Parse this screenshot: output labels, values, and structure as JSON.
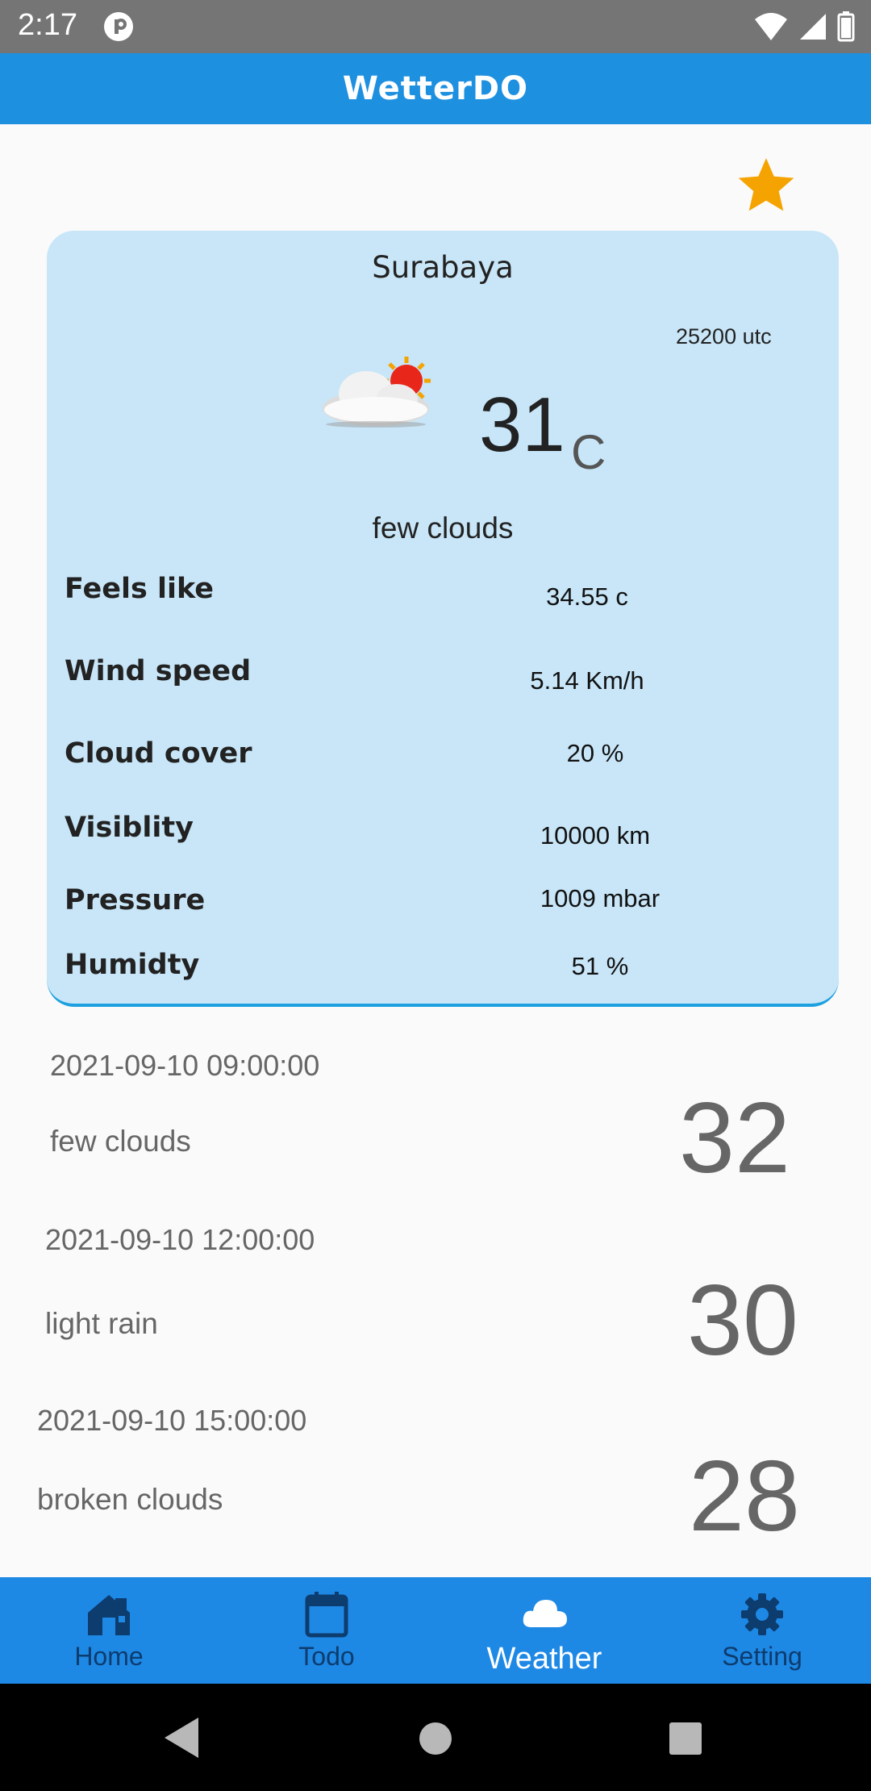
{
  "status_bar": {
    "time": "2:17"
  },
  "app_bar": {
    "title": "WetterDO"
  },
  "current": {
    "city": "Surabaya",
    "utc": "25200 utc",
    "temperature": "31",
    "unit": "C",
    "description": "few clouds",
    "details": [
      {
        "label": "Feels like",
        "value": "34.55 c"
      },
      {
        "label": "Wind speed",
        "value": "5.14 Km/h"
      },
      {
        "label": "Cloud cover",
        "value": "20 %"
      },
      {
        "label": "Visiblity",
        "value": "10000 km"
      },
      {
        "label": "Pressure",
        "value": "1009 mbar"
      },
      {
        "label": "Humidty",
        "value": "51 %"
      }
    ]
  },
  "forecast": [
    {
      "date": "2021-09-10 09:00:00",
      "description": "few clouds",
      "temp": "32"
    },
    {
      "date": "2021-09-10 12:00:00",
      "description": "light rain",
      "temp": "30"
    },
    {
      "date": "2021-09-10 15:00:00",
      "description": "broken clouds",
      "temp": "28"
    }
  ],
  "bottom_nav": [
    {
      "label": "Home",
      "icon": "home-icon"
    },
    {
      "label": "Todo",
      "icon": "calendar-icon"
    },
    {
      "label": "Weather",
      "icon": "cloud-icon"
    },
    {
      "label": "Setting",
      "icon": "gear-icon"
    }
  ],
  "colors": {
    "primary": "#1e88e5",
    "card": "#c8e6f8",
    "star": "#f5a300"
  }
}
